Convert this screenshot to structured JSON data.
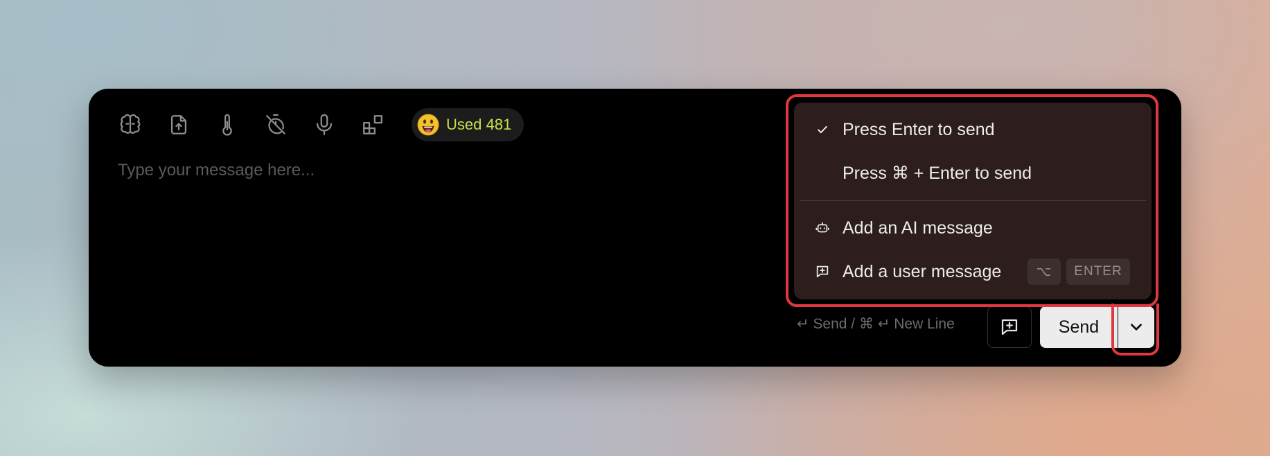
{
  "toolbar": {
    "icons": [
      "brain-icon",
      "file-upload-icon",
      "thermometer-icon",
      "timer-off-icon",
      "microphone-icon",
      "widgets-icon"
    ],
    "usage_label": "Used 481",
    "usage_color": "#c9e04a"
  },
  "input": {
    "placeholder": "Type your message here...",
    "value": ""
  },
  "footer": {
    "hint": "↵ Send / ⌘ ↵ New Line",
    "send_label": "Send"
  },
  "dropdown": {
    "items": [
      {
        "label": "Press Enter to send",
        "selected": true,
        "icon": "check-icon"
      },
      {
        "label": "Press ⌘ + Enter to send",
        "selected": false
      },
      {
        "label": "Add an AI message",
        "icon": "bot-icon"
      },
      {
        "label": "Add a user message",
        "icon": "message-plus-icon",
        "shortcut": [
          "⌥",
          "ENTER"
        ]
      }
    ]
  },
  "colors": {
    "highlight": "#e0383c",
    "menu_bg": "#2e1d1d",
    "composer_bg": "#000000"
  }
}
